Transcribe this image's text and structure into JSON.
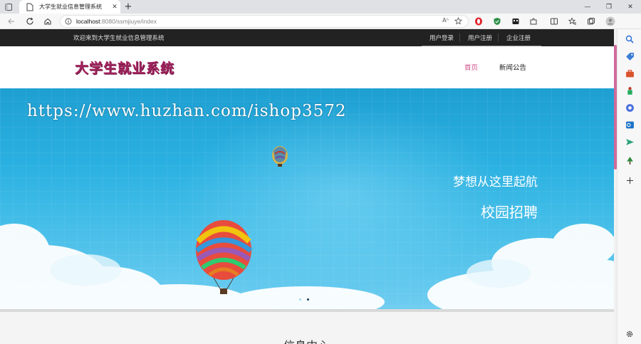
{
  "browser": {
    "tab_title": "大学生就业信息管理系统",
    "tab_close": "✕",
    "new_tab": "+",
    "url_host": "localhost",
    "url_path": ":8080/ssmjiuye/index",
    "read_aloud": "Aᴬ",
    "icons": [
      "back-icon",
      "refresh-icon",
      "home-icon",
      "info-icon",
      "star-add-icon",
      "opera-icon",
      "shield-icon",
      "extension-icon",
      "split-screen-icon",
      "favorites-icon",
      "collections-icon",
      "profile-icon"
    ],
    "window_controls": [
      "—",
      "❐",
      "✕"
    ]
  },
  "sidebar_icons": [
    "search-icon",
    "tag-icon",
    "briefcase-icon",
    "games-icon",
    "office-icon",
    "outlook-icon",
    "send-icon",
    "tree-icon",
    "add-icon",
    "settings-icon"
  ],
  "topbar": {
    "welcome": "欢迎来到大学生就业信息管理系统",
    "links": [
      {
        "icon": "",
        "label": "用户登录"
      },
      {
        "icon": "",
        "label": "用户注册"
      },
      {
        "icon": "",
        "label": "企业注册"
      }
    ]
  },
  "header": {
    "logo": "大学生就业系统",
    "nav": [
      {
        "label": "首页",
        "active": true
      },
      {
        "label": "新闻公告",
        "active": false
      }
    ]
  },
  "banner": {
    "watermark": "https://www.huzhan.com/ishop3572",
    "slogan_line1": "梦想从这里起航",
    "slogan_line2": "校园招聘",
    "slides": 2,
    "active_slide": 1
  },
  "section": {
    "title": "信息中心"
  },
  "colors": {
    "accent": "#d24f88",
    "logo": "#a3245f",
    "topbar_bg": "#222222",
    "banner_sky": "#2bb1e1"
  }
}
